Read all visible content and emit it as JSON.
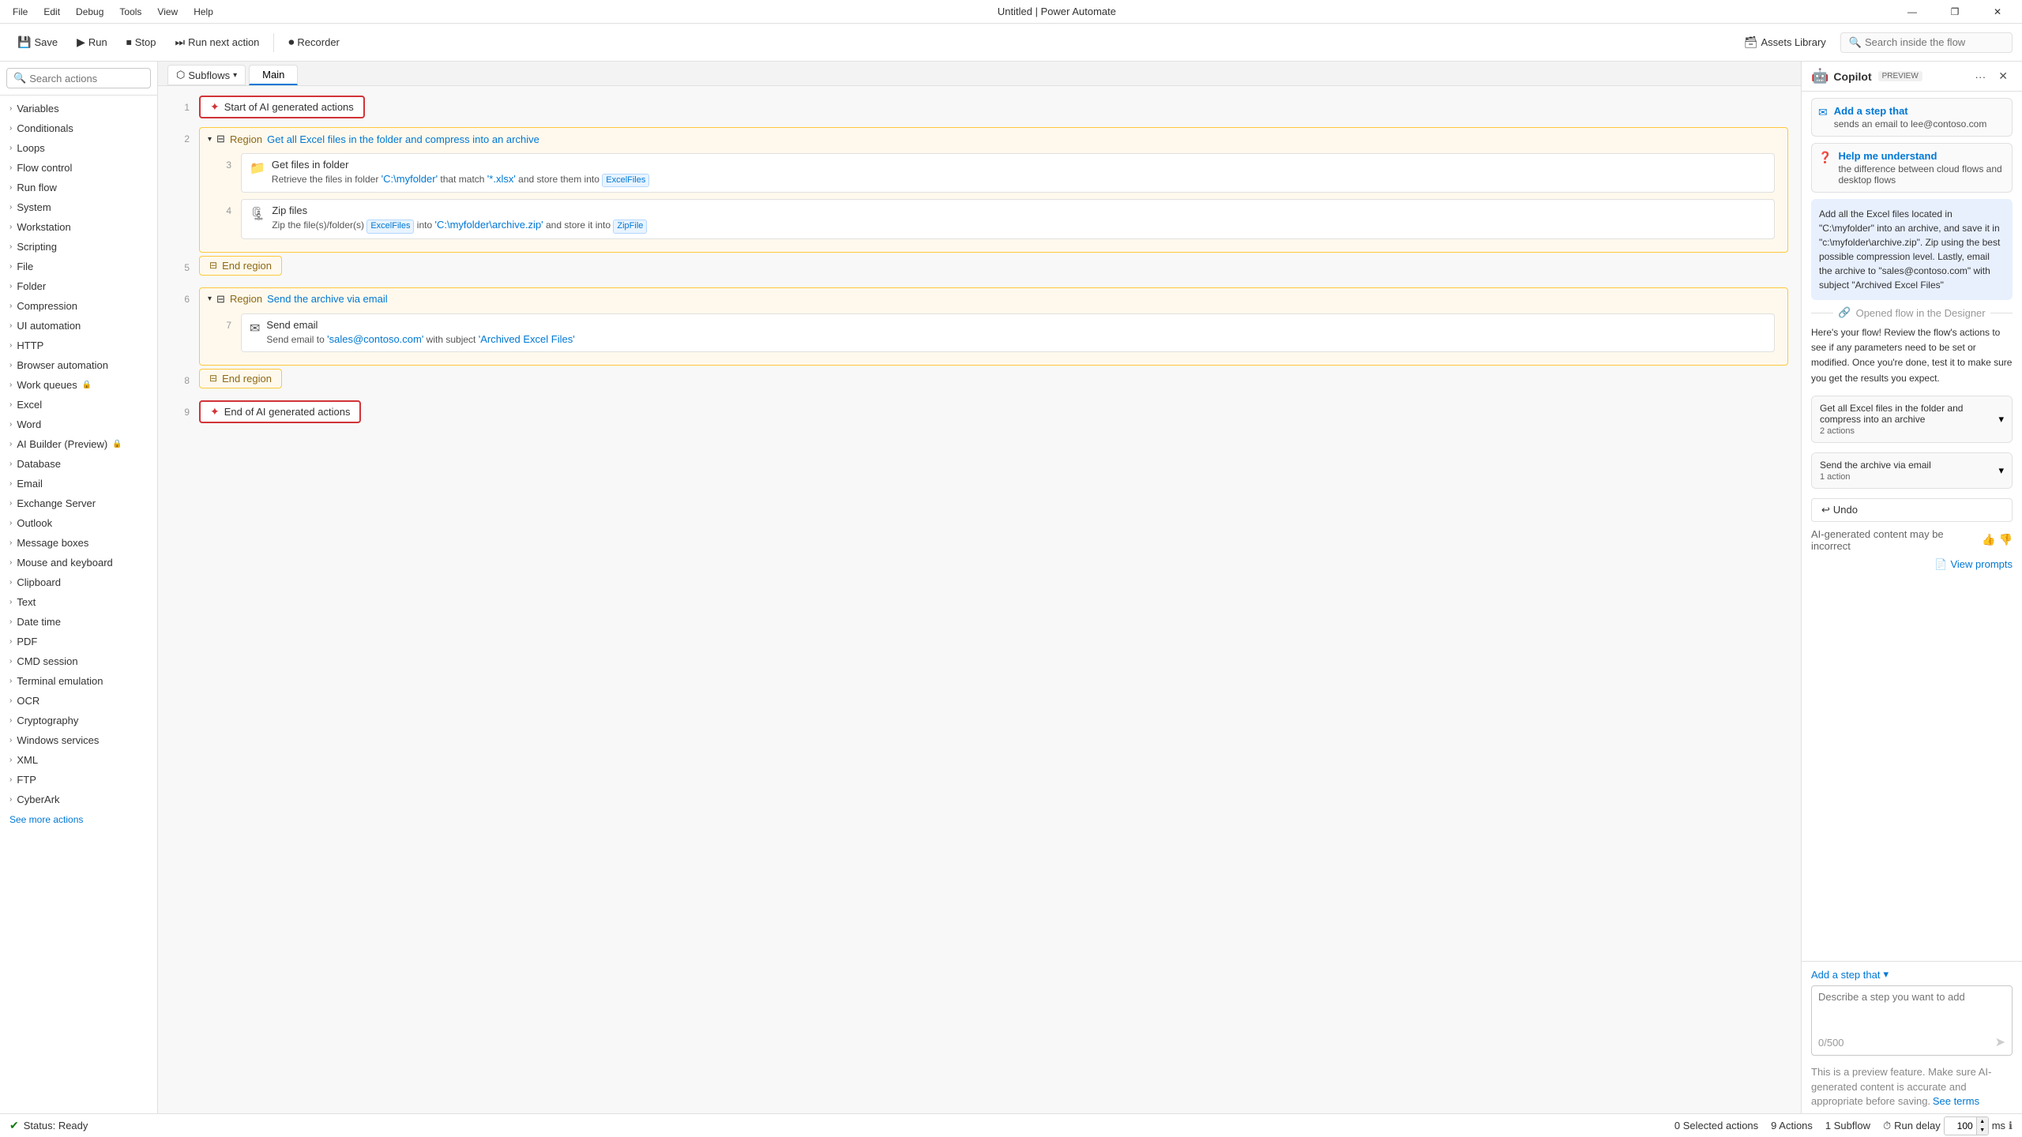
{
  "titleBar": {
    "appName": "Untitled | Power Automate",
    "menus": [
      "File",
      "Edit",
      "Debug",
      "Tools",
      "View",
      "Help"
    ],
    "windowControls": [
      "—",
      "❐",
      "✕"
    ]
  },
  "toolbar": {
    "save": "Save",
    "run": "Run",
    "stop": "Stop",
    "runNextAction": "Run next action",
    "recorder": "Recorder",
    "assetsLibrary": "Assets Library",
    "searchInsidePlaceholder": "Search inside the flow"
  },
  "sidebar": {
    "searchPlaceholder": "Search actions",
    "items": [
      {
        "label": "Variables"
      },
      {
        "label": "Conditionals"
      },
      {
        "label": "Loops"
      },
      {
        "label": "Flow control"
      },
      {
        "label": "Run flow"
      },
      {
        "label": "System"
      },
      {
        "label": "Workstation"
      },
      {
        "label": "Scripting"
      },
      {
        "label": "File"
      },
      {
        "label": "Folder"
      },
      {
        "label": "Compression"
      },
      {
        "label": "UI automation"
      },
      {
        "label": "HTTP"
      },
      {
        "label": "Browser automation"
      },
      {
        "label": "Work queues"
      },
      {
        "label": "Excel"
      },
      {
        "label": "Word"
      },
      {
        "label": "AI Builder (Preview)"
      },
      {
        "label": "Database"
      },
      {
        "label": "Email"
      },
      {
        "label": "Exchange Server"
      },
      {
        "label": "Outlook"
      },
      {
        "label": "Message boxes"
      },
      {
        "label": "Mouse and keyboard"
      },
      {
        "label": "Clipboard"
      },
      {
        "label": "Text"
      },
      {
        "label": "Date time"
      },
      {
        "label": "PDF"
      },
      {
        "label": "CMD session"
      },
      {
        "label": "Terminal emulation"
      },
      {
        "label": "OCR"
      },
      {
        "label": "Cryptography"
      },
      {
        "label": "Windows services"
      },
      {
        "label": "XML"
      },
      {
        "label": "FTP"
      },
      {
        "label": "CyberArk"
      }
    ],
    "seeMore": "See more actions"
  },
  "canvas": {
    "tabs": {
      "subflows": "Subflows",
      "main": "Main"
    },
    "rows": [
      {
        "number": "1",
        "type": "ai-start",
        "label": "Start of AI generated actions"
      },
      {
        "number": "2",
        "type": "region",
        "regionLabel": "Region",
        "regionTitle": "Get all Excel files in the folder and compress into an archive",
        "children": [
          {
            "number": "3",
            "type": "action",
            "title": "Get files in folder",
            "desc": "Retrieve the files in folder 'C:\\myfolder' that match '*.xlsx' and store them into",
            "var": "ExcelFiles"
          },
          {
            "number": "4",
            "type": "action",
            "title": "Zip files",
            "desc1": "Zip the file(s)/folder(s)",
            "var1": "ExcelFiles",
            "desc2": "into 'C:\\myfolder\\archive.zip' and store it into",
            "var2": "ZipFile"
          }
        ]
      },
      {
        "number": "5",
        "type": "end-region",
        "label": "End region"
      },
      {
        "number": "6",
        "type": "region",
        "regionLabel": "Region",
        "regionTitle": "Send the archive via email",
        "children": [
          {
            "number": "7",
            "type": "action",
            "title": "Send email",
            "desc": "Send email to 'sales@contoso.com' with subject 'Archived Excel Files'"
          }
        ]
      },
      {
        "number": "8",
        "type": "end-region",
        "label": "End region"
      },
      {
        "number": "9",
        "type": "ai-end",
        "label": "End of AI generated actions"
      }
    ]
  },
  "copilot": {
    "title": "Copilot",
    "preview": "PREVIEW",
    "suggestions": [
      {
        "icon": "✉",
        "title": "Add a step that",
        "sub": "sends an email to lee@contoso.com"
      },
      {
        "icon": "❓",
        "title": "Help me understand",
        "sub": "the difference between cloud flows and desktop flows"
      }
    ],
    "message": "Add all the Excel files located in \"C:\\myfolder\" into an archive, and save it in \"c:\\myfolder\\archive.zip\". Zip using the best possible compression level. Lastly, email the archive to \"sales@contoso.com\" with subject \"Archived Excel Files\"",
    "dividerText": "Opened flow in the Designer",
    "flowResponse": "Here's your flow! Review the flow's actions to see if any parameters need to be set or modified. Once you're done, test it to make sure you get the results you expect.",
    "actionCards": [
      {
        "title": "Get all Excel files in the folder and compress into an archive",
        "count": "2 actions"
      },
      {
        "title": "Send the archive via email",
        "count": "1 action"
      }
    ],
    "undoLabel": "Undo",
    "disclaimer": "AI-generated content may be incorrect",
    "viewPrompts": "View prompts",
    "addStepLabel": "Add a step that",
    "textareaPlaceholder": "Describe a step you want to add",
    "charCount": "0/500",
    "footerNote": "This is a preview feature. Make sure AI-generated content is accurate and appropriate before saving.",
    "seeTerms": "See terms"
  },
  "statusBar": {
    "status": "Status: Ready",
    "selectedActions": "0 Selected actions",
    "totalActions": "9 Actions",
    "subflows": "1 Subflow",
    "runDelayLabel": "Run delay",
    "runDelayValue": "100",
    "runDelayUnit": "ms"
  }
}
